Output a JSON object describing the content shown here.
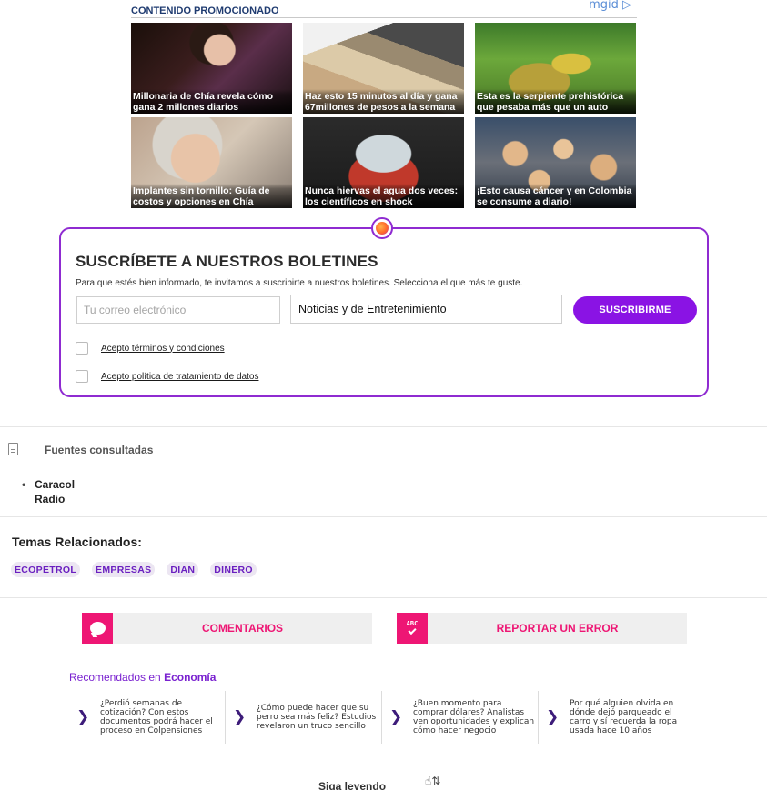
{
  "promo": {
    "title": "CONTENIDO PROMOCIONADO",
    "brand": "mgid",
    "cards": [
      {
        "caption": "Millonaria de Chía revela cómo gana 2 millones diarios"
      },
      {
        "caption": "Haz esto 15 minutos al día y gana 67millones de pesos a la semana"
      },
      {
        "caption": "Esta es la serpiente prehistórica que pesaba más que un auto"
      },
      {
        "caption": "Implantes sin tornillo: Guía de costos y opciones en Chía"
      },
      {
        "caption": "Nunca hiervas el agua dos veces: los científicos en shock"
      },
      {
        "caption": "¡Esto causa cáncer y en Colombia se consume a diario!"
      }
    ]
  },
  "newsletter": {
    "title": "SUSCRÍBETE A NUESTROS BOLETINES",
    "description": "Para que estés bien informado, te invitamos a suscribirte a nuestros boletines. Selecciona el que más te guste.",
    "email_placeholder": "Tu correo electrónico",
    "selected_option": "Noticias y de Entretenimiento",
    "button_label": "SUSCRIBIRME",
    "terms_label": "Acepto términos y condiciones",
    "privacy_label": "Acepto política de tratamiento de datos",
    "accent_color": "#8a13e4"
  },
  "sources": {
    "title": "Fuentes consultadas",
    "items": [
      "Caracol",
      "Radio"
    ]
  },
  "topics": {
    "title": "Temas Relacionados:",
    "tags": [
      "ECOPETROL",
      "EMPRESAS",
      "DIAN",
      "DINERO"
    ]
  },
  "actions": {
    "comments_label": "COMENTARIOS",
    "report_label": "REPORTAR UN ERROR",
    "report_icon_text": "ABC",
    "accent_color": "#ee1674"
  },
  "recommended": {
    "prefix": "Recomendados en ",
    "section": "Economía",
    "items": [
      {
        "text": "¿Perdió semanas de cotización? Con estos documentos podrá hacer el proceso en Colpensiones"
      },
      {
        "text": "¿Cómo puede hacer que su perro sea más feliz? Estudios revelaron un truco sencillo"
      },
      {
        "text": "¿Buen momento para comprar dólares? Analistas ven oportunidades y explican cómo hacer negocio"
      },
      {
        "text": "Por qué alguien olvida en dónde dejó parqueado el carro y sí recuerda la ropa usada hace 10 años"
      }
    ]
  },
  "footer": {
    "partial_text": "Siga leyendo"
  }
}
